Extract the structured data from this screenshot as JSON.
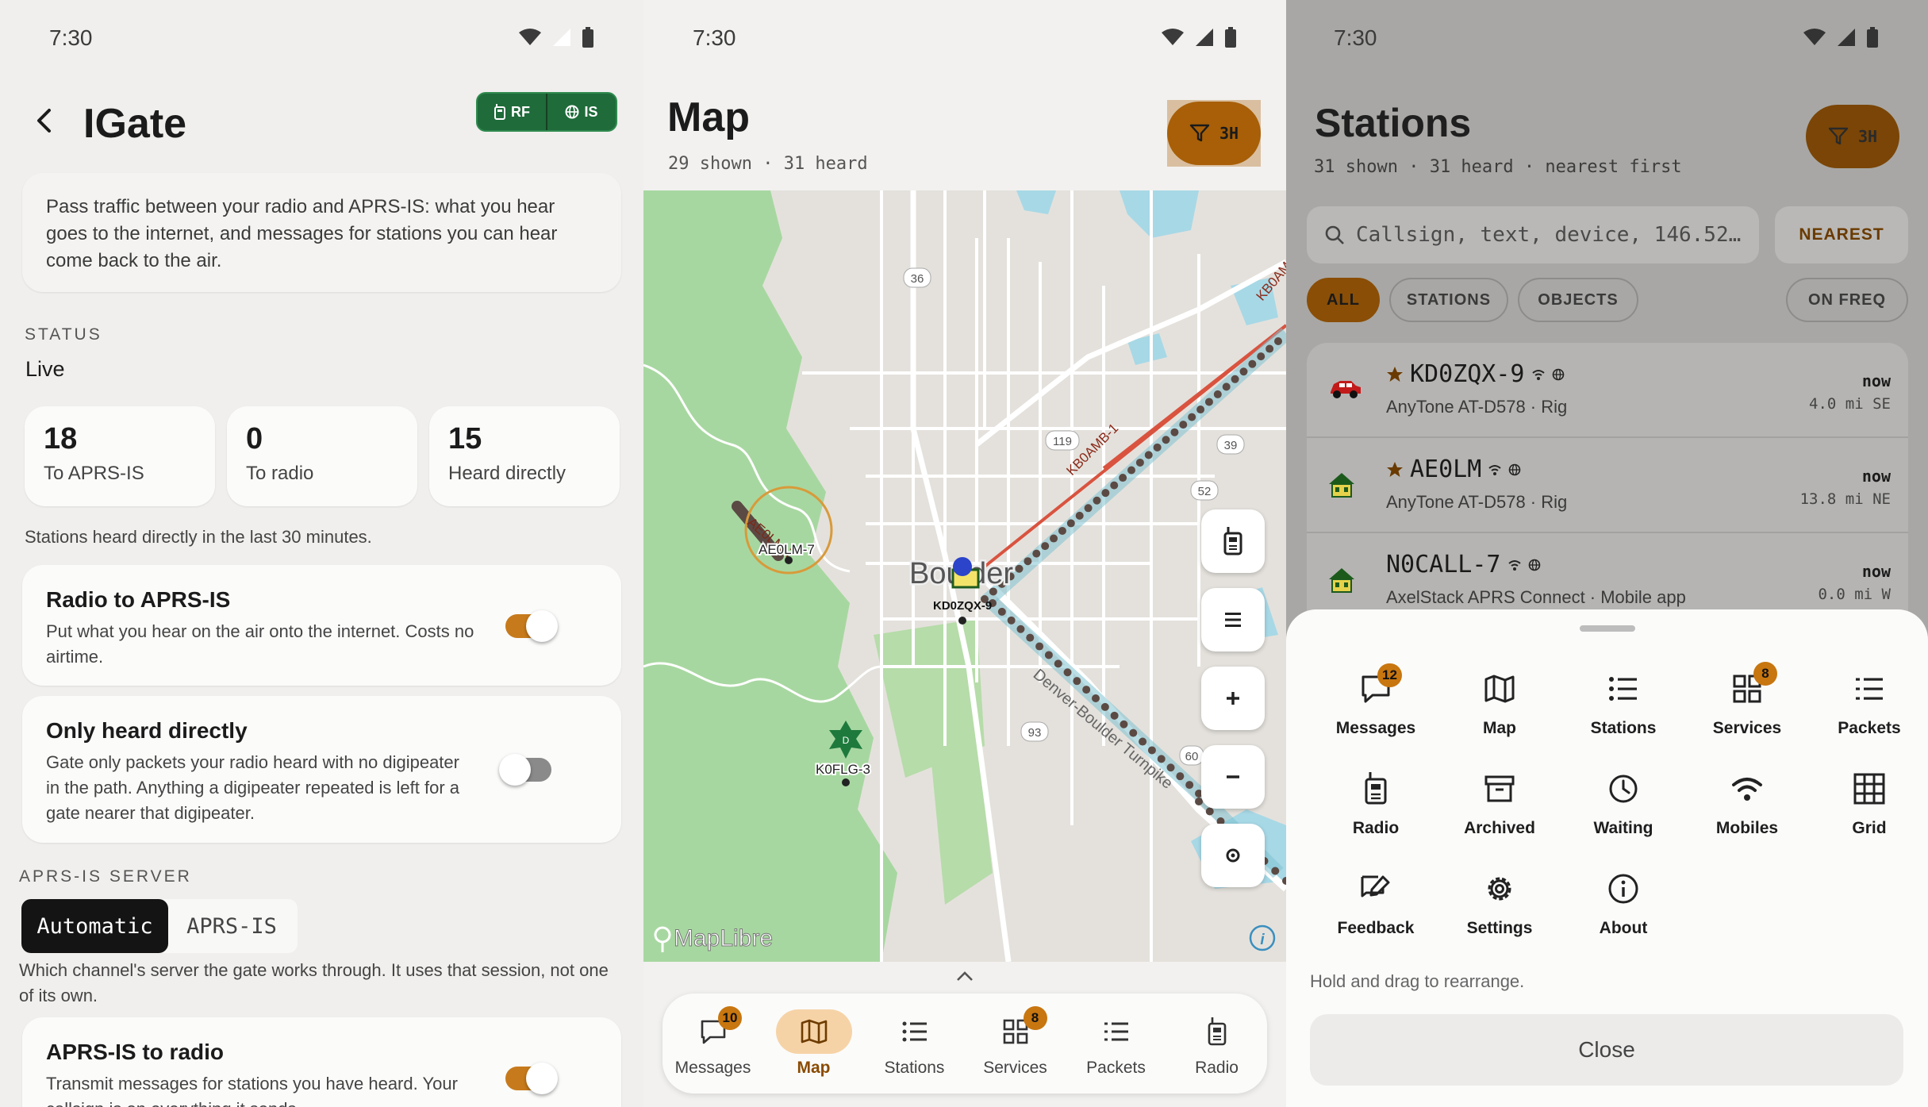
{
  "status_time": "7:30",
  "igate": {
    "title": "IGate",
    "mode": {
      "rf": "RF",
      "is": "IS"
    },
    "intro": "Pass traffic between your radio and APRS-IS: what you hear goes to the internet, and messages for stations you can hear come back to the air.",
    "status_header": "STATUS",
    "status_value": "Live",
    "stats": [
      {
        "num": "18",
        "label": "To APRS-IS"
      },
      {
        "num": "0",
        "label": "To radio"
      },
      {
        "num": "15",
        "label": "Heard directly"
      }
    ],
    "stats_note": "Stations heard directly in the last 30 minutes.",
    "radio_to_is": {
      "title": "Radio to APRS-IS",
      "desc": "Put what you hear on the air onto the internet. Costs no airtime.",
      "enabled": true
    },
    "only_heard": {
      "title": "Only heard directly",
      "desc": "Gate only packets your radio heard with no digipeater in the path. Anything a digipeater repeated is left for a gate nearer that digipeater.",
      "enabled": false
    },
    "server_header": "APRS-IS SERVER",
    "server_options": {
      "automatic": "Automatic",
      "aprs_is": "APRS-IS"
    },
    "server_note": "Which channel's server the gate works through. It uses that session, not one of its own.",
    "is_to_radio": {
      "title": "APRS-IS to radio",
      "desc": "Transmit messages for stations you have heard. Your callsign is on everything it sends.",
      "enabled": true
    }
  },
  "map": {
    "title": "Map",
    "subtitle": "29 shown · 31 heard",
    "filter_label": "3H",
    "labels": {
      "ae0lm_track": "AE0LM-7",
      "ae0lm_pos": "AE0LM-7",
      "kb0amb_a": "KB0AMB-1",
      "kb0amb_b": "KB0AM",
      "city": "Boulder",
      "cluster": "KD0ZQX-9",
      "k0flg": "K0FLG-3",
      "turnpike": "Denver-Boulder Turnpike",
      "r36": "36",
      "r119": "119",
      "r39": "39",
      "r52": "52",
      "r93": "93",
      "r60": "60",
      "maplibre": "MapLibre"
    },
    "nav": [
      {
        "label": "Messages",
        "badge": "10",
        "icon": "message-icon"
      },
      {
        "label": "Map",
        "badge": "",
        "icon": "map-icon",
        "active": true
      },
      {
        "label": "Stations",
        "badge": "",
        "icon": "list-icon"
      },
      {
        "label": "Services",
        "badge": "8",
        "icon": "grid-icon"
      },
      {
        "label": "Packets",
        "badge": "",
        "icon": "packets-icon"
      },
      {
        "label": "Radio",
        "badge": "",
        "icon": "radio-icon"
      }
    ]
  },
  "stations": {
    "title": "Stations",
    "subtitle": "31 shown · 31 heard · nearest first",
    "filter_label": "3H",
    "search_placeholder": "Callsign, text, device, 146.52…",
    "sort_label": "NEAREST",
    "chips": [
      "ALL",
      "STATIONS",
      "OBJECTS",
      "ON FREQ"
    ],
    "rows": [
      {
        "call": "KD0ZQX-9",
        "starred": true,
        "device": "AnyTone AT-D578 · Rig",
        "when": "now",
        "dist": "4.0 mi SE",
        "icon": "car-icon"
      },
      {
        "call": "AE0LM",
        "starred": true,
        "device": "AnyTone AT-D578 · Rig",
        "when": "now",
        "dist": "13.8 mi NE",
        "icon": "house-icon"
      },
      {
        "call": "N0CALL-7",
        "starred": false,
        "device": "AxelStack APRS Connect · Mobile app",
        "when": "now",
        "dist": "0.0 mi W",
        "icon": "house-icon"
      }
    ],
    "sheet": {
      "items": [
        {
          "label": "Messages",
          "badge": "12"
        },
        {
          "label": "Map",
          "badge": ""
        },
        {
          "label": "Stations",
          "badge": ""
        },
        {
          "label": "Services",
          "badge": "8"
        },
        {
          "label": "Packets",
          "badge": ""
        },
        {
          "label": "Radio",
          "badge": ""
        },
        {
          "label": "Archived",
          "badge": ""
        },
        {
          "label": "Waiting",
          "badge": ""
        },
        {
          "label": "Mobiles",
          "badge": ""
        },
        {
          "label": "Grid",
          "badge": ""
        },
        {
          "label": "Feedback",
          "badge": ""
        },
        {
          "label": "Settings",
          "badge": ""
        },
        {
          "label": "About",
          "badge": ""
        }
      ],
      "hint": "Hold and drag to rearrange.",
      "close_label": "Close"
    }
  },
  "colors": {
    "accent": "#a85f07",
    "rf_green": "#1f6b3a",
    "badge": "#c8760f",
    "track": "#5b4a44",
    "kb0amb_line": "#d9533f"
  }
}
